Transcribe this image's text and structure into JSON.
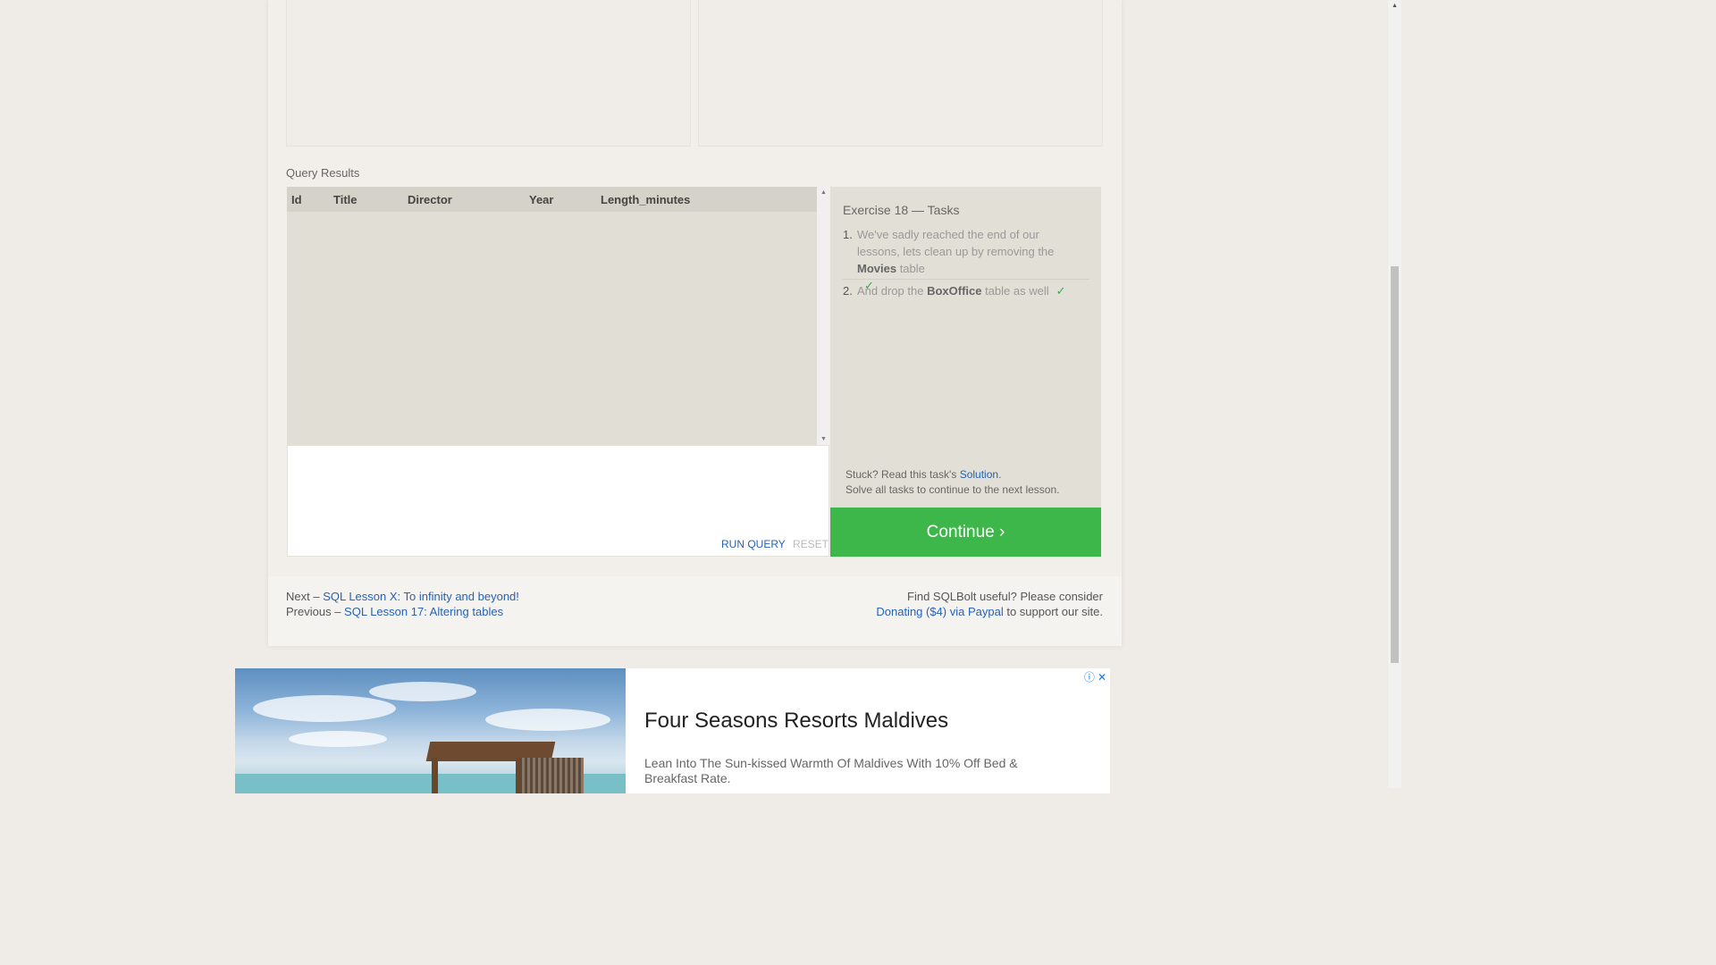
{
  "results": {
    "label": "Query Results",
    "columns": [
      "Id",
      "Title",
      "Director",
      "Year",
      "Length_minutes"
    ]
  },
  "editor": {
    "run_label": "RUN QUERY",
    "reset_label": "RESET"
  },
  "tasks": {
    "title": "Exercise 18 — Tasks",
    "items": [
      {
        "num": "1.",
        "pre": "We've sadly reached the end of our lessons, lets clean up by removing the ",
        "bold": "Movies",
        "post": " table",
        "check": "✓"
      },
      {
        "num": "2.",
        "pre": "And drop the ",
        "bold": "BoxOffice",
        "post": " table as well",
        "check": "✓"
      }
    ],
    "stuck_prefix": "Stuck? Read this task's ",
    "solution_link": "Solution",
    "stuck_suffix": ".",
    "solve_all": "Solve all tasks to continue to the next lesson."
  },
  "continue_label": "Continue ›",
  "footer": {
    "next_prefix": "Next – ",
    "next_link": "SQL Lesson X: To infinity and beyond!",
    "prev_prefix": "Previous – ",
    "prev_link": "SQL Lesson 17: Altering tables",
    "useful_text": "Find SQLBolt useful? Please consider",
    "donate_link": "Donating ($4) via Paypal",
    "donate_suffix": " to support our site."
  },
  "ad": {
    "title": "Four Seasons Resorts Maldives",
    "description": "Lean Into The Sun-kissed Warmth Of Maldives With 10% Off Bed & Breakfast Rate.",
    "info_icon": "ⓘ",
    "close_icon": "✕"
  },
  "colors": {
    "accent_green": "#3db74a",
    "link_blue": "#2762b3"
  }
}
